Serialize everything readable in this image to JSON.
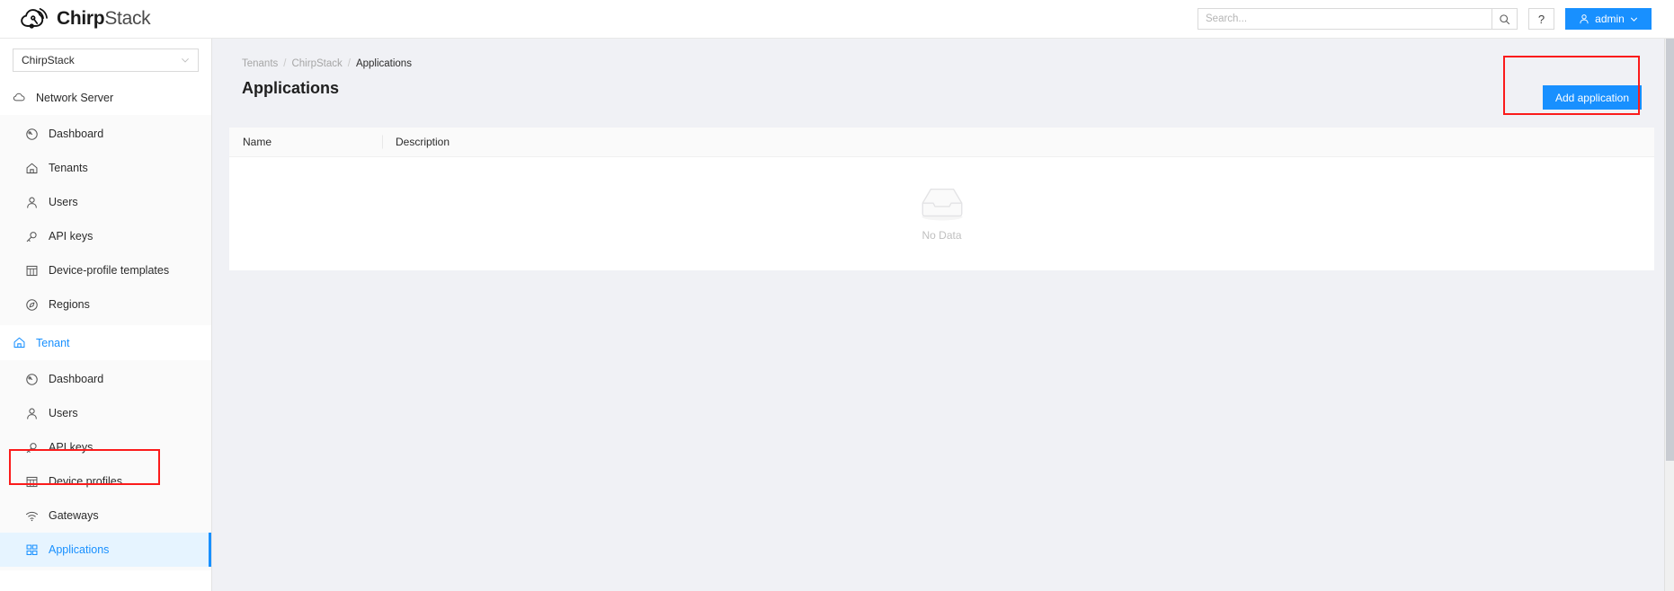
{
  "app": {
    "brand_bold": "Chirp",
    "brand_light": "Stack",
    "logo_icon": "cloud-signal-logo"
  },
  "topbar": {
    "search": {
      "placeholder": "Search...",
      "value": "",
      "icon": "search-icon"
    },
    "help_label": "?",
    "user": {
      "name": "admin",
      "icon": "user-icon",
      "caret": "chevron-down-icon"
    }
  },
  "sidebar": {
    "tenant_selector": {
      "value": "ChirpStack",
      "caret": "chevron-down-icon"
    },
    "sections": [
      {
        "label": "Network Server",
        "icon": "cloud-icon",
        "active": false,
        "items": [
          {
            "label": "Dashboard",
            "icon": "gauge-icon",
            "selected": false
          },
          {
            "label": "Tenants",
            "icon": "home-icon",
            "selected": false
          },
          {
            "label": "Users",
            "icon": "user-icon",
            "selected": false
          },
          {
            "label": "API keys",
            "icon": "key-icon",
            "selected": false
          },
          {
            "label": "Device-profile templates",
            "icon": "table-icon",
            "selected": false
          },
          {
            "label": "Regions",
            "icon": "compass-icon",
            "selected": false
          }
        ]
      },
      {
        "label": "Tenant",
        "icon": "home-icon",
        "active": true,
        "items": [
          {
            "label": "Dashboard",
            "icon": "gauge-icon",
            "selected": false
          },
          {
            "label": "Users",
            "icon": "user-icon",
            "selected": false
          },
          {
            "label": "API keys",
            "icon": "key-icon",
            "selected": false
          },
          {
            "label": "Device profiles",
            "icon": "table-icon",
            "selected": false
          },
          {
            "label": "Gateways",
            "icon": "wifi-icon",
            "selected": false
          },
          {
            "label": "Applications",
            "icon": "grid-icon",
            "selected": true
          }
        ]
      }
    ]
  },
  "main": {
    "breadcrumb": [
      {
        "label": "Tenants",
        "current": false
      },
      {
        "label": "ChirpStack",
        "current": false
      },
      {
        "label": "Applications",
        "current": true
      }
    ],
    "breadcrumb_separator": "/",
    "page_title": "Applications",
    "add_button_label": "Add application",
    "table": {
      "columns": [
        "Name",
        "Description"
      ],
      "rows": [],
      "empty_text": "No Data",
      "empty_icon": "inbox-icon"
    }
  },
  "annotations": [
    {
      "name": "add-application-highlight",
      "color": "#fb1b1b"
    },
    {
      "name": "applications-menu-highlight",
      "color": "#fb1b1b"
    }
  ],
  "colors": {
    "accent": "#1890ff",
    "selected_bg": "#e6f4ff",
    "page_bg": "#f0f1f5",
    "annotation": "#fb1b1b"
  }
}
